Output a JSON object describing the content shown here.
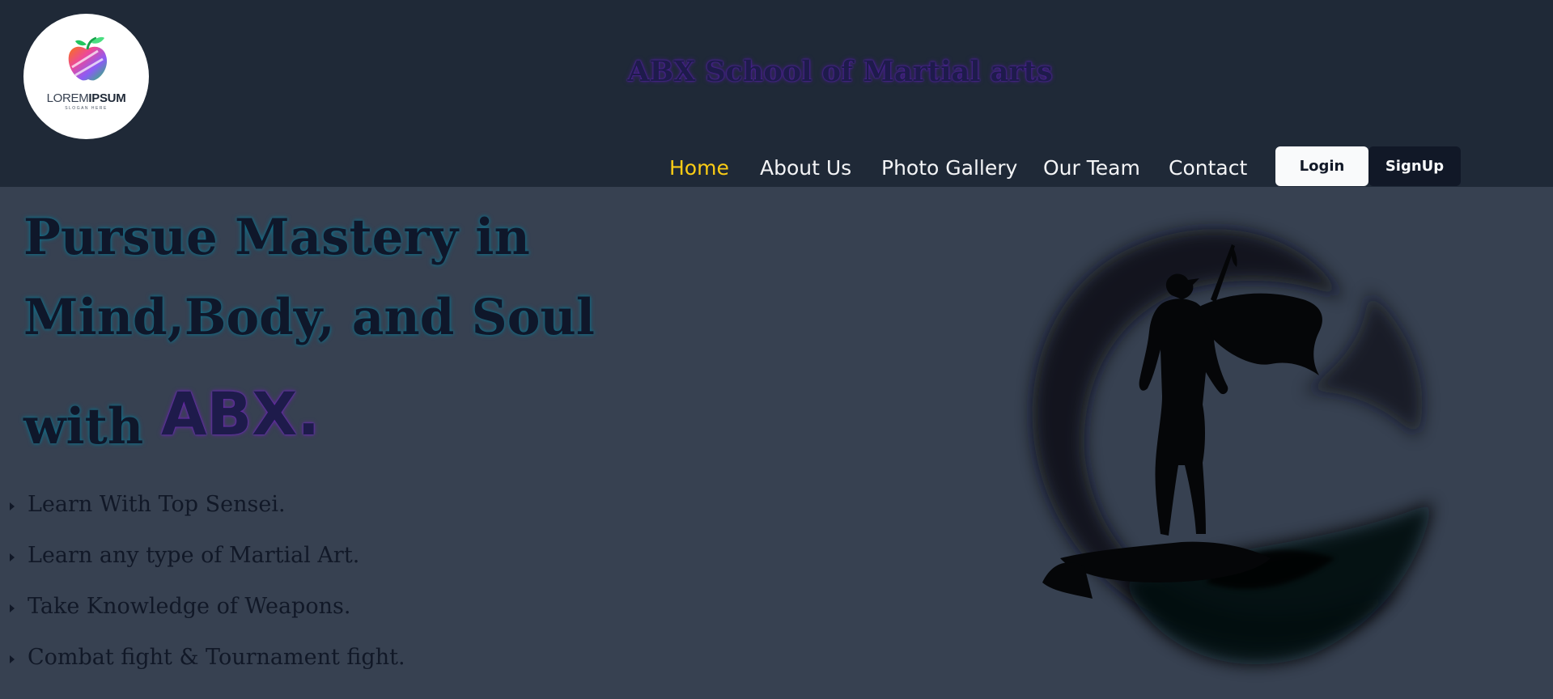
{
  "header": {
    "logo": {
      "icon": "apple-logo-icon",
      "text_light": "LOREM",
      "text_bold": "IPSUM",
      "slogan": "SLOGAN HERE"
    },
    "site_title": "ABX School of Martial arts",
    "nav": [
      {
        "label": "Home",
        "active": true
      },
      {
        "label": "About Us",
        "active": false
      },
      {
        "label": "Photo Gallery",
        "active": false
      },
      {
        "label": "Our Team",
        "active": false
      },
      {
        "label": "Contact",
        "active": false
      }
    ],
    "login_label": "Login",
    "signup_label": "SignUp"
  },
  "hero": {
    "line1": "Pursue Mastery in",
    "line2": "Mind,Body, and Soul",
    "line3": "with",
    "brand": "ABX."
  },
  "features": [
    "Learn With Top Sensei.",
    "Learn any type of Martial Art.",
    "Take Knowledge of Weapons.",
    "Combat fight & Tournament fight."
  ],
  "illustration": {
    "icon": "martial-artist-silhouette-icon"
  },
  "colors": {
    "header_bg": "#1f2937",
    "page_bg": "#374151",
    "nav_active": "#facc15",
    "nav_text": "#f3f4f6",
    "title_text": "#1e1b4b"
  }
}
